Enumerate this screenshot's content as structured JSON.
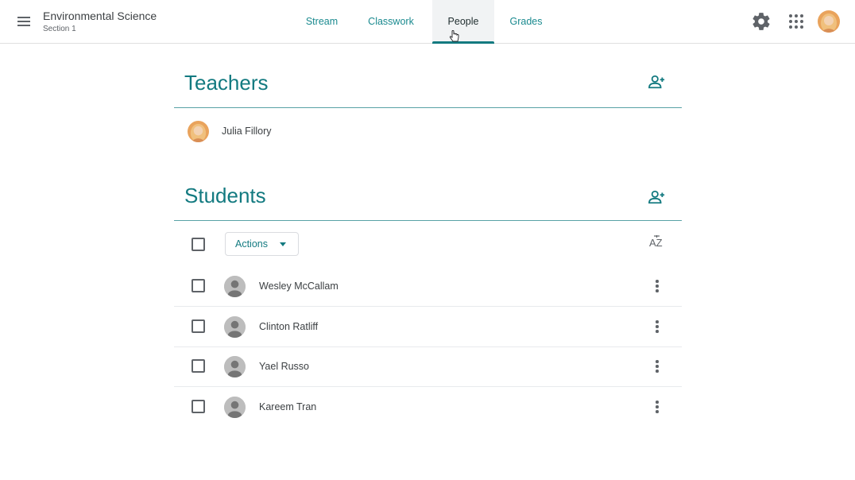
{
  "header": {
    "class_title": "Environmental Science",
    "class_section": "Section 1",
    "tabs": [
      {
        "label": "Stream"
      },
      {
        "label": "Classwork"
      },
      {
        "label": "People"
      },
      {
        "label": "Grades"
      }
    ],
    "active_tab": "People"
  },
  "teachers": {
    "title": "Teachers",
    "list": [
      {
        "name": "Julia Fillory"
      }
    ]
  },
  "students": {
    "title": "Students",
    "actions_label": "Actions",
    "sort_label": "AZ",
    "list": [
      {
        "name": "Wesley McCallam"
      },
      {
        "name": "Clinton Ratliff"
      },
      {
        "name": "Yael Russo"
      },
      {
        "name": "Kareem Tran"
      }
    ]
  },
  "colors": {
    "accent": "#137a80",
    "tab_text": "#1a8a8f",
    "text": "#3c4043",
    "icon": "#5f6368"
  }
}
